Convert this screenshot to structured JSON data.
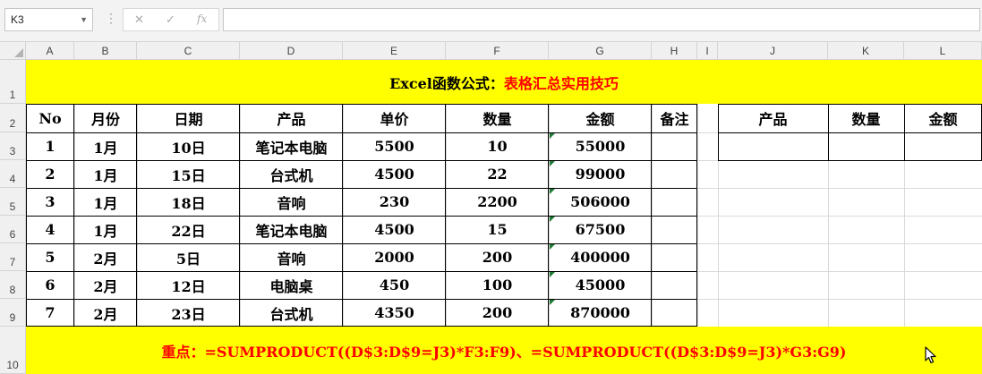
{
  "name_box": "K3",
  "formula_icons": {
    "cancel": "✕",
    "enter": "✓",
    "fx": "fx"
  },
  "formula_value": "",
  "columns": [
    "A",
    "B",
    "C",
    "D",
    "E",
    "F",
    "G",
    "H",
    "I",
    "J",
    "K",
    "L"
  ],
  "rows": [
    "1",
    "2",
    "3",
    "4",
    "5",
    "6",
    "7",
    "8",
    "9",
    "10"
  ],
  "title": {
    "prefix": "Excel函数公式：",
    "suffix": "表格汇总实用技巧"
  },
  "table": {
    "headers": [
      "No",
      "月份",
      "日期",
      "产品",
      "单价",
      "数量",
      "金额",
      "备注"
    ],
    "rows": [
      [
        "1",
        "1月",
        "10日",
        "笔记本电脑",
        "5500",
        "10",
        "55000",
        ""
      ],
      [
        "2",
        "1月",
        "15日",
        "台式机",
        "4500",
        "22",
        "99000",
        ""
      ],
      [
        "3",
        "1月",
        "18日",
        "音响",
        "230",
        "2200",
        "506000",
        ""
      ],
      [
        "4",
        "1月",
        "22日",
        "笔记本电脑",
        "4500",
        "15",
        "67500",
        ""
      ],
      [
        "5",
        "2月",
        "5日",
        "音响",
        "2000",
        "200",
        "400000",
        ""
      ],
      [
        "6",
        "2月",
        "12日",
        "电脑桌",
        "450",
        "100",
        "45000",
        ""
      ],
      [
        "7",
        "2月",
        "23日",
        "台式机",
        "4350",
        "200",
        "870000",
        ""
      ]
    ]
  },
  "summary": {
    "headers": [
      "产品",
      "数量",
      "金额"
    ],
    "values": [
      "",
      "",
      ""
    ]
  },
  "note": "重点：=SUMPRODUCT((D$3:D$9=J3)*F3:F9)、=SUMPRODUCT((D$3:D$9=J3)*G3:G9)",
  "colors": {
    "highlight": "#ffff00",
    "accent_text": "#ff0000",
    "error_indicator": "#1e7b34"
  }
}
